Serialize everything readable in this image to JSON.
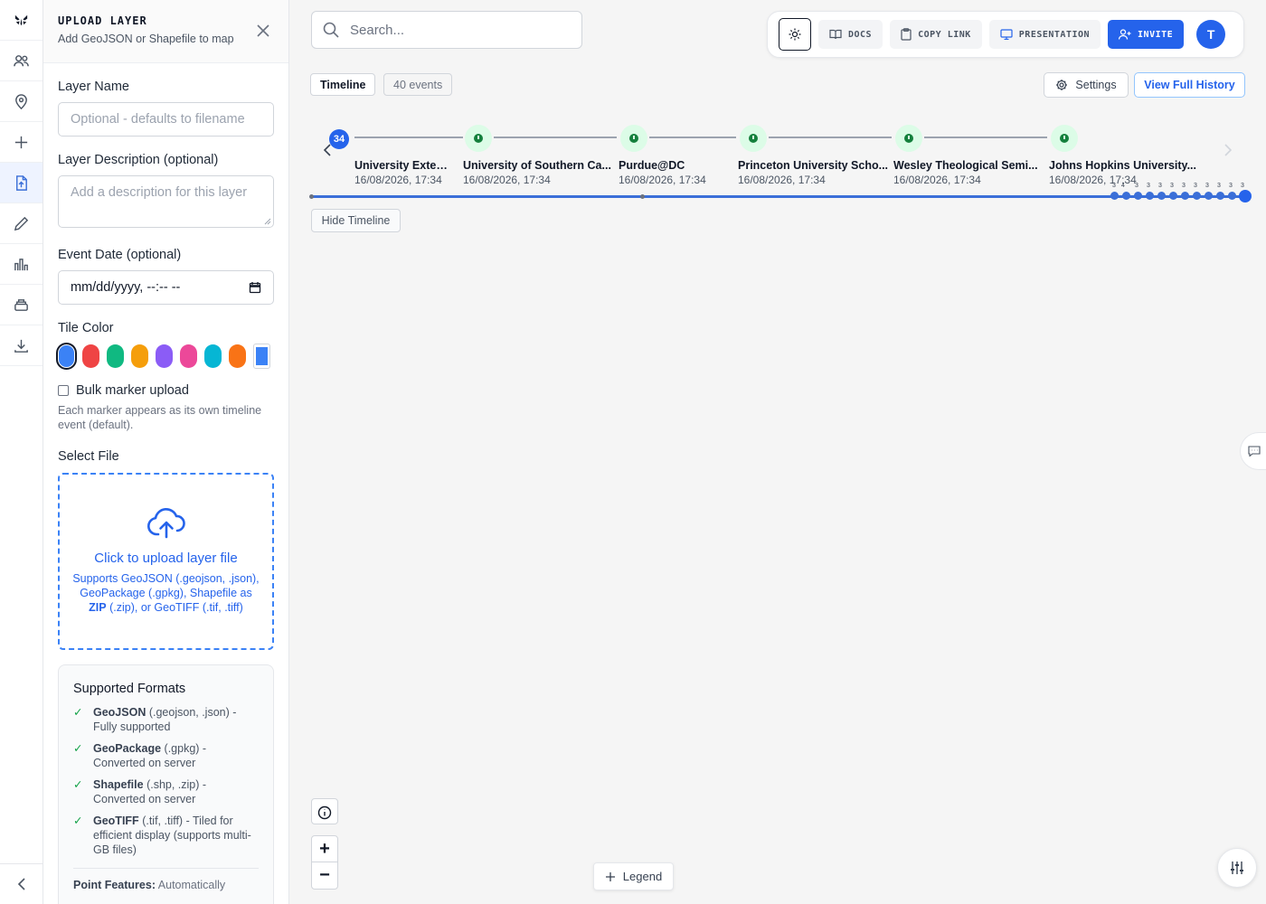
{
  "rail": {
    "items": [
      {
        "icon": "logo-icon"
      },
      {
        "icon": "users-icon"
      },
      {
        "icon": "map-pin-icon"
      },
      {
        "icon": "plus-icon"
      },
      {
        "icon": "file-upload-icon",
        "active": true
      },
      {
        "icon": "pencil-icon"
      },
      {
        "icon": "bar-chart-icon"
      },
      {
        "icon": "layers-icon"
      },
      {
        "icon": "download-icon"
      }
    ],
    "collapse_icon": "chevron-left-icon"
  },
  "panel": {
    "title": "UPLOAD LAYER",
    "subtitle": "Add GeoJSON or Shapefile to map",
    "layer_name_label": "Layer Name",
    "layer_name_placeholder": "Optional - defaults to filename",
    "description_label": "Layer Description (optional)",
    "description_placeholder": "Add a description for this layer",
    "event_date_label": "Event Date (optional)",
    "event_date_value": "mm/dd/yyyy, --:-- --",
    "tile_color_label": "Tile Color",
    "tile_colors": [
      "#3b82f6",
      "#ef4444",
      "#10b981",
      "#f59e0b",
      "#8b5cf6",
      "#ec4899",
      "#06b6d4",
      "#f97316"
    ],
    "selected_color": "#3b82f6",
    "bulk_label": "Bulk marker upload",
    "bulk_hint": "Each marker appears as its own timeline event (default).",
    "select_file_label": "Select File",
    "upload_title": "Click to upload layer file",
    "upload_sub_1": "Supports GeoJSON (.geojson, .json), GeoPackage (.gpkg), Shapefile as",
    "upload_sub_zip": "ZIP",
    "upload_sub_2": "(.zip), or GeoTIFF (.tif, .tiff)",
    "formats_title": "Supported Formats",
    "formats": [
      {
        "name": "GeoJSON",
        "desc": "(.geojson, .json) - Fully supported"
      },
      {
        "name": "GeoPackage",
        "desc": "(.gpkg) - Converted on server"
      },
      {
        "name": "Shapefile",
        "desc": "(.shp, .zip) - Converted on server"
      },
      {
        "name": "GeoTIFF",
        "desc": "(.tif, .tiff) - Tiled for efficient display (supports multi-GB files)"
      }
    ],
    "point_features_name": "Point Features:",
    "point_features_desc": "Automatically"
  },
  "toolbar": {
    "search_placeholder": "Search...",
    "docs": "DOCS",
    "copy_link": "COPY LINK",
    "presentation": "PRESENTATION",
    "invite": "INVITE",
    "avatar": "T"
  },
  "timeline": {
    "tab": "Timeline",
    "count": "40 events",
    "settings": "Settings",
    "history": "View Full History",
    "badge": "34",
    "events": [
      {
        "name": "University Exten...",
        "time": "16/08/2026, 17:34"
      },
      {
        "name": "University of Southern Ca...",
        "time": "16/08/2026, 17:34"
      },
      {
        "name": "Purdue@DC",
        "time": "16/08/2026, 17:34"
      },
      {
        "name": "Princeton University Scho...",
        "time": "16/08/2026, 17:34"
      },
      {
        "name": "Wesley Theological Semi...",
        "time": "16/08/2026, 17:34"
      },
      {
        "name": "Johns Hopkins University...",
        "time": "16/08/2026, 17:34"
      }
    ],
    "mini_labels": [
      "3",
      "4",
      "3",
      "3",
      "3",
      "3",
      "3",
      "3",
      "3",
      "3",
      "3",
      "3"
    ],
    "hide": "Hide Timeline"
  },
  "map": {
    "zoom_in": "+",
    "zoom_out": "−",
    "legend": "Legend"
  }
}
